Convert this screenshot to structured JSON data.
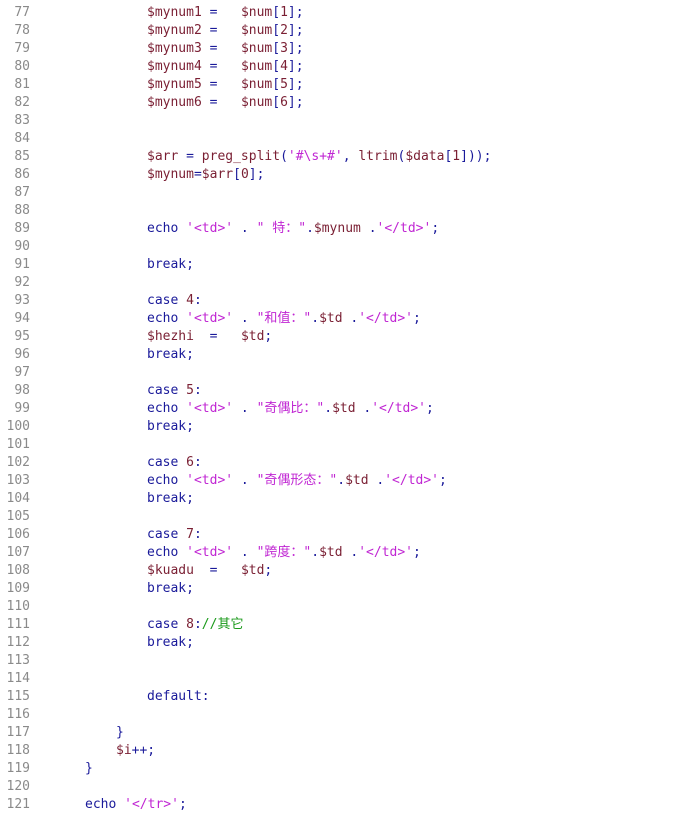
{
  "editor": {
    "lines": [
      {
        "n": "77",
        "indent": 2,
        "tokens": [
          [
            "var",
            "$mynum1"
          ],
          [
            "op",
            " =   "
          ],
          [
            "var",
            "$num"
          ],
          [
            "op",
            "["
          ],
          [
            "num",
            "1"
          ],
          [
            "op",
            "];"
          ]
        ]
      },
      {
        "n": "78",
        "indent": 2,
        "tokens": [
          [
            "var",
            "$mynum2"
          ],
          [
            "op",
            " =   "
          ],
          [
            "var",
            "$num"
          ],
          [
            "op",
            "["
          ],
          [
            "num",
            "2"
          ],
          [
            "op",
            "];"
          ]
        ]
      },
      {
        "n": "79",
        "indent": 2,
        "tokens": [
          [
            "var",
            "$mynum3"
          ],
          [
            "op",
            " =   "
          ],
          [
            "var",
            "$num"
          ],
          [
            "op",
            "["
          ],
          [
            "num",
            "3"
          ],
          [
            "op",
            "];"
          ]
        ]
      },
      {
        "n": "80",
        "indent": 2,
        "tokens": [
          [
            "var",
            "$mynum4"
          ],
          [
            "op",
            " =   "
          ],
          [
            "var",
            "$num"
          ],
          [
            "op",
            "["
          ],
          [
            "num",
            "4"
          ],
          [
            "op",
            "];"
          ]
        ]
      },
      {
        "n": "81",
        "indent": 2,
        "tokens": [
          [
            "var",
            "$mynum5"
          ],
          [
            "op",
            " =   "
          ],
          [
            "var",
            "$num"
          ],
          [
            "op",
            "["
          ],
          [
            "num",
            "5"
          ],
          [
            "op",
            "];"
          ]
        ]
      },
      {
        "n": "82",
        "indent": 2,
        "tokens": [
          [
            "var",
            "$mynum6"
          ],
          [
            "op",
            " =   "
          ],
          [
            "var",
            "$num"
          ],
          [
            "op",
            "["
          ],
          [
            "num",
            "6"
          ],
          [
            "op",
            "];"
          ]
        ]
      },
      {
        "n": "83",
        "indent": 0,
        "tokens": []
      },
      {
        "n": "84",
        "indent": 0,
        "tokens": []
      },
      {
        "n": "85",
        "indent": 2,
        "tokens": [
          [
            "var",
            "$arr"
          ],
          [
            "op",
            " = "
          ],
          [
            "fn",
            "preg_split"
          ],
          [
            "op",
            "("
          ],
          [
            "str",
            "'#\\s+#'"
          ],
          [
            "op",
            ", "
          ],
          [
            "fn",
            "ltrim"
          ],
          [
            "op",
            "("
          ],
          [
            "var",
            "$data"
          ],
          [
            "op",
            "["
          ],
          [
            "num",
            "1"
          ],
          [
            "op",
            "]));"
          ]
        ]
      },
      {
        "n": "86",
        "indent": 2,
        "tokens": [
          [
            "var",
            "$mynum"
          ],
          [
            "op",
            "="
          ],
          [
            "var",
            "$arr"
          ],
          [
            "op",
            "["
          ],
          [
            "num",
            "0"
          ],
          [
            "op",
            "];"
          ]
        ]
      },
      {
        "n": "87",
        "indent": 0,
        "tokens": []
      },
      {
        "n": "88",
        "indent": 0,
        "tokens": []
      },
      {
        "n": "89",
        "indent": 2,
        "tokens": [
          [
            "kw",
            "echo "
          ],
          [
            "str",
            "'<td>'"
          ],
          [
            "op",
            " . "
          ],
          [
            "str",
            "\" 特：\""
          ],
          [
            "op",
            "."
          ],
          [
            "var",
            "$mynum"
          ],
          [
            "op",
            " ."
          ],
          [
            "str",
            "'</td>'"
          ],
          [
            "op",
            ";"
          ]
        ]
      },
      {
        "n": "90",
        "indent": 0,
        "tokens": []
      },
      {
        "n": "91",
        "indent": 2,
        "tokens": [
          [
            "kw",
            "break"
          ],
          [
            "op",
            ";"
          ]
        ]
      },
      {
        "n": "92",
        "indent": 0,
        "tokens": []
      },
      {
        "n": "93",
        "indent": 2,
        "tokens": [
          [
            "kw",
            "case "
          ],
          [
            "num",
            "4"
          ],
          [
            "op",
            ":"
          ]
        ]
      },
      {
        "n": "94",
        "indent": 2,
        "tokens": [
          [
            "kw",
            "echo "
          ],
          [
            "str",
            "'<td>'"
          ],
          [
            "op",
            " . "
          ],
          [
            "str",
            "\"和值：\""
          ],
          [
            "op",
            "."
          ],
          [
            "var",
            "$td"
          ],
          [
            "op",
            " ."
          ],
          [
            "str",
            "'</td>'"
          ],
          [
            "op",
            ";"
          ]
        ]
      },
      {
        "n": "95",
        "indent": 2,
        "tokens": [
          [
            "var",
            "$hezhi"
          ],
          [
            "op",
            "  =   "
          ],
          [
            "var",
            "$td"
          ],
          [
            "op",
            ";"
          ]
        ]
      },
      {
        "n": "96",
        "indent": 2,
        "tokens": [
          [
            "kw",
            "break"
          ],
          [
            "op",
            ";"
          ]
        ]
      },
      {
        "n": "97",
        "indent": 0,
        "tokens": []
      },
      {
        "n": "98",
        "indent": 2,
        "tokens": [
          [
            "kw",
            "case "
          ],
          [
            "num",
            "5"
          ],
          [
            "op",
            ":"
          ]
        ]
      },
      {
        "n": "99",
        "indent": 2,
        "tokens": [
          [
            "kw",
            "echo "
          ],
          [
            "str",
            "'<td>'"
          ],
          [
            "op",
            " . "
          ],
          [
            "str",
            "\"奇偶比：\""
          ],
          [
            "op",
            "."
          ],
          [
            "var",
            "$td"
          ],
          [
            "op",
            " ."
          ],
          [
            "str",
            "'</td>'"
          ],
          [
            "op",
            ";"
          ]
        ]
      },
      {
        "n": "100",
        "indent": 2,
        "tokens": [
          [
            "kw",
            "break"
          ],
          [
            "op",
            ";"
          ]
        ]
      },
      {
        "n": "101",
        "indent": 0,
        "tokens": []
      },
      {
        "n": "102",
        "indent": 2,
        "tokens": [
          [
            "kw",
            "case "
          ],
          [
            "num",
            "6"
          ],
          [
            "op",
            ":"
          ]
        ]
      },
      {
        "n": "103",
        "indent": 2,
        "tokens": [
          [
            "kw",
            "echo "
          ],
          [
            "str",
            "'<td>'"
          ],
          [
            "op",
            " . "
          ],
          [
            "str",
            "\"奇偶形态：\""
          ],
          [
            "op",
            "."
          ],
          [
            "var",
            "$td"
          ],
          [
            "op",
            " ."
          ],
          [
            "str",
            "'</td>'"
          ],
          [
            "op",
            ";"
          ]
        ]
      },
      {
        "n": "104",
        "indent": 2,
        "tokens": [
          [
            "kw",
            "break"
          ],
          [
            "op",
            ";"
          ]
        ]
      },
      {
        "n": "105",
        "indent": 0,
        "tokens": []
      },
      {
        "n": "106",
        "indent": 2,
        "tokens": [
          [
            "kw",
            "case "
          ],
          [
            "num",
            "7"
          ],
          [
            "op",
            ":"
          ]
        ]
      },
      {
        "n": "107",
        "indent": 2,
        "tokens": [
          [
            "kw",
            "echo "
          ],
          [
            "str",
            "'<td>'"
          ],
          [
            "op",
            " . "
          ],
          [
            "str",
            "\"跨度：\""
          ],
          [
            "op",
            "."
          ],
          [
            "var",
            "$td"
          ],
          [
            "op",
            " ."
          ],
          [
            "str",
            "'</td>'"
          ],
          [
            "op",
            ";"
          ]
        ]
      },
      {
        "n": "108",
        "indent": 2,
        "tokens": [
          [
            "var",
            "$kuadu"
          ],
          [
            "op",
            "  =   "
          ],
          [
            "var",
            "$td"
          ],
          [
            "op",
            ";"
          ]
        ]
      },
      {
        "n": "109",
        "indent": 2,
        "tokens": [
          [
            "kw",
            "break"
          ],
          [
            "op",
            ";"
          ]
        ]
      },
      {
        "n": "110",
        "indent": 0,
        "tokens": []
      },
      {
        "n": "111",
        "indent": 2,
        "tokens": [
          [
            "kw",
            "case "
          ],
          [
            "num",
            "8"
          ],
          [
            "op",
            ":"
          ],
          [
            "comment",
            "//其它"
          ]
        ]
      },
      {
        "n": "112",
        "indent": 2,
        "tokens": [
          [
            "kw",
            "break"
          ],
          [
            "op",
            ";"
          ]
        ]
      },
      {
        "n": "113",
        "indent": 0,
        "tokens": []
      },
      {
        "n": "114",
        "indent": 0,
        "tokens": []
      },
      {
        "n": "115",
        "indent": 2,
        "tokens": [
          [
            "kw",
            "default"
          ],
          [
            "op",
            ":"
          ]
        ]
      },
      {
        "n": "116",
        "indent": 0,
        "tokens": []
      },
      {
        "n": "117",
        "indent": 1,
        "tokens": [
          [
            "op",
            "}"
          ]
        ]
      },
      {
        "n": "118",
        "indent": 1,
        "tokens": [
          [
            "var",
            "$i"
          ],
          [
            "op",
            "++;"
          ]
        ]
      },
      {
        "n": "119",
        "indent": 0,
        "tokens": [
          [
            "op",
            "}"
          ]
        ]
      },
      {
        "n": "120",
        "indent": 0,
        "tokens": []
      },
      {
        "n": "121",
        "indent": 0,
        "tokens": [
          [
            "kw",
            "echo "
          ],
          [
            "str",
            "'</tr>'"
          ],
          [
            "op",
            ";"
          ]
        ]
      }
    ]
  },
  "colors": {
    "line_number": "#8a8a8a",
    "keyword": "#1a1a9a",
    "variable": "#7a1f33",
    "string": "#c026d3",
    "comment": "#1a9a1a",
    "background": "#ffffff"
  }
}
